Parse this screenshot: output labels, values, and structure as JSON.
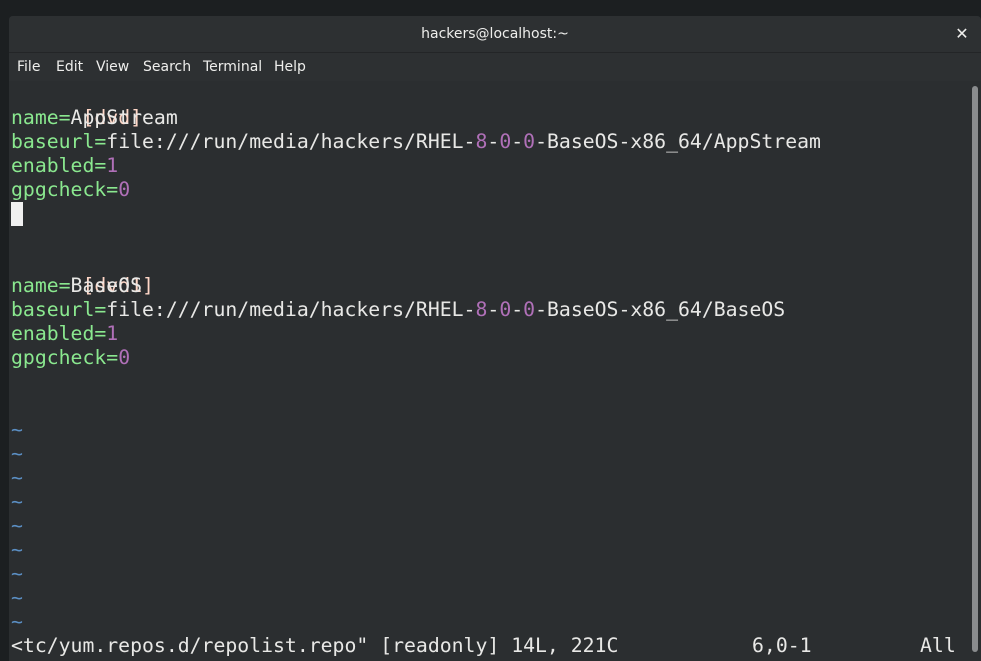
{
  "window": {
    "title": "hackers@localhost:~",
    "close_glyph": "✕"
  },
  "menu": [
    "File",
    "Edit",
    "View",
    "Search",
    "Terminal",
    "Help"
  ],
  "colors": {
    "background": "#2b2e30",
    "text": "#e8e8e6",
    "section": "#ffd7c7",
    "key": "#8ae88f",
    "number": "#b070b8",
    "tilde": "#5b8fc4"
  },
  "editor": {
    "block1": {
      "section": "[dvd]",
      "name_key": "name=",
      "name_val": "AppStream",
      "baseurl_key": "baseurl=",
      "baseurl_a": "file:///run/media/hackers/RHEL-",
      "baseurl_n1": "8",
      "baseurl_d1": "-",
      "baseurl_n2": "0",
      "baseurl_d2": "-",
      "baseurl_n3": "0",
      "baseurl_b": "-BaseOS-x86_64/AppStream",
      "enabled_key": "enabled=",
      "enabled_val": "1",
      "gpgcheck_key": "gpgcheck=",
      "gpgcheck_val": "0"
    },
    "block2": {
      "section": "[dvd1]",
      "name_key": "name=",
      "name_val": "BaseOS",
      "baseurl_key": "baseurl=",
      "baseurl_a": "file:///run/media/hackers/RHEL-",
      "baseurl_n1": "8",
      "baseurl_d1": "-",
      "baseurl_n2": "0",
      "baseurl_d2": "-",
      "baseurl_n3": "0",
      "baseurl_b": "-BaseOS-x86_64/BaseOS",
      "enabled_key": "enabled=",
      "enabled_val": "1",
      "gpgcheck_key": "gpgcheck=",
      "gpgcheck_val": "0"
    },
    "tilde": "~",
    "status": {
      "file": "<tc/yum.repos.d/repolist.repo\" [readonly] 14L, 221C",
      "position": "6,0-1",
      "scroll": "All"
    }
  }
}
